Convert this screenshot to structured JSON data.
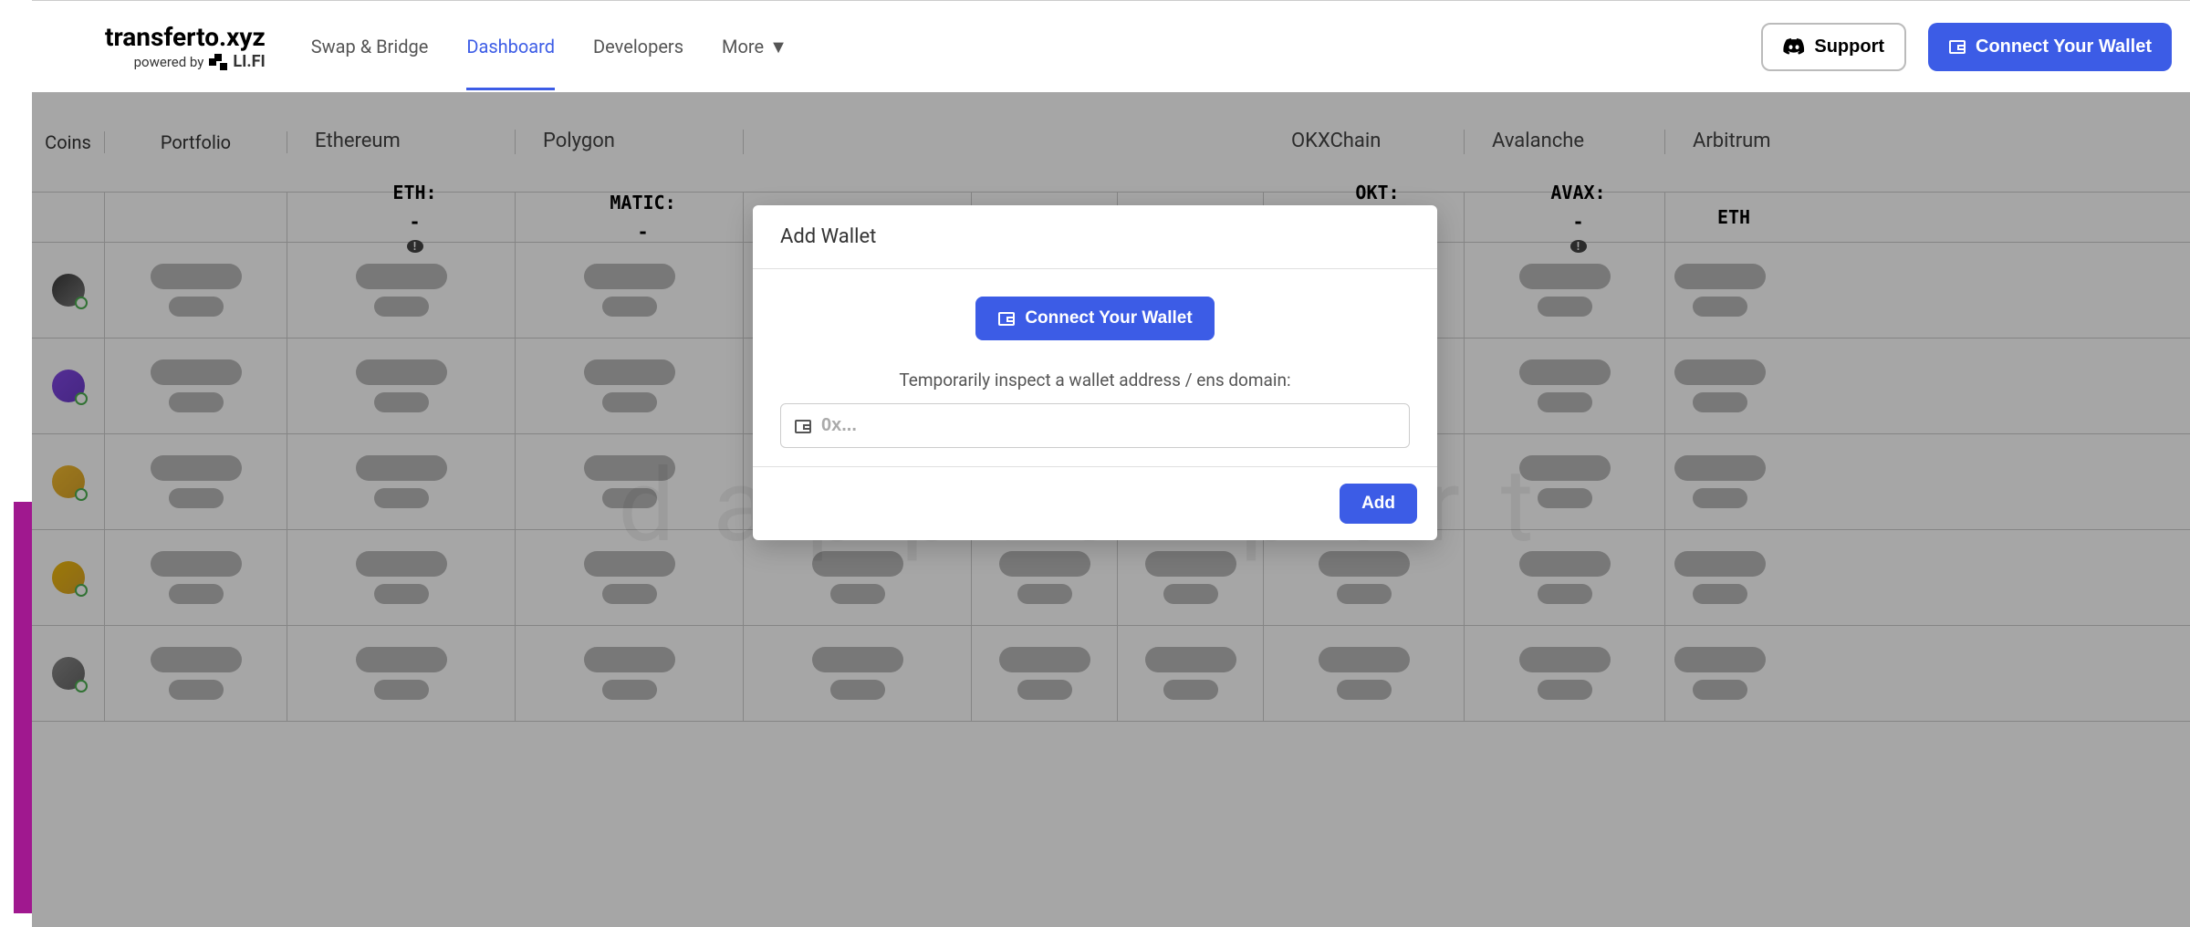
{
  "logo": {
    "main": "transferto.xyz",
    "powered_by": "powered by",
    "lifi": "LI.FI"
  },
  "nav": {
    "swap": "Swap & Bridge",
    "dashboard": "Dashboard",
    "developers": "Developers",
    "more": "More"
  },
  "header_buttons": {
    "support": "Support",
    "connect": "Connect Your Wallet"
  },
  "table": {
    "coins_header": "Coins",
    "portfolio_header": "Portfolio",
    "chains": [
      {
        "name": "Ethereum",
        "symbol": "ETH:",
        "value": "-"
      },
      {
        "name": "Polygon",
        "symbol": "MATIC:",
        "value": "-"
      },
      {
        "name": "",
        "symbol": "",
        "value": ""
      },
      {
        "name": "",
        "symbol": "",
        "value": ""
      },
      {
        "name": "",
        "symbol": "",
        "value": ""
      },
      {
        "name": "OKXChain",
        "symbol": "OKT:",
        "value": "-"
      },
      {
        "name": "Avalanche",
        "symbol": "AVAX:",
        "value": "-"
      },
      {
        "name": "Arbitrum",
        "symbol": "ETH",
        "value": ""
      }
    ],
    "coin_icons": [
      {
        "color1": "#3a3a3a",
        "color2": "#7a7a7a"
      },
      {
        "color1": "#8247e5",
        "color2": "#6b3bc9"
      },
      {
        "color1": "#f3ba2f",
        "color2": "#d8a428"
      },
      {
        "color1": "#f0b90b",
        "color2": "#d8a428"
      },
      {
        "color1": "#888",
        "color2": "#666"
      }
    ]
  },
  "modal": {
    "title": "Add Wallet",
    "connect_label": "Connect Your Wallet",
    "note": "Temporarily inspect a wallet address / ens domain:",
    "placeholder": "0x...",
    "add_label": "Add"
  },
  "watermark": "dapp.expert"
}
